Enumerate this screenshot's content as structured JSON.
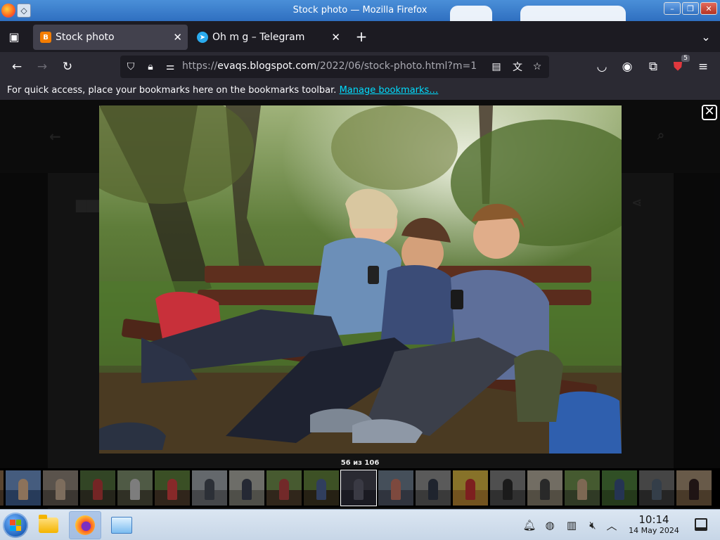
{
  "window": {
    "title": "Stock photo — Mozilla Firefox"
  },
  "tabs": [
    {
      "label": "Stock photo",
      "favicon": "blogger-icon",
      "active": true
    },
    {
      "label": "Oh m g – Telegram",
      "favicon": "telegram-icon",
      "active": false
    }
  ],
  "address": {
    "scheme": "https://",
    "host": "evaqs.blogspot.com",
    "path": "/2022/06/stock-photo.html?m=1",
    "extensions_badge": "5"
  },
  "bookmarks_bar": {
    "message": "For quick access, place your bookmarks here on the bookmarks toolbar.",
    "link": "Manage bookmarks…"
  },
  "lightbox": {
    "counter": "56 из 106",
    "close_symbol": "✕",
    "photo_description_icon": "photo-children-on-bench",
    "thumbnail_count": 20,
    "active_thumbnail": 10
  },
  "taskbar": {
    "time": "10:14",
    "date": "14 May 2024"
  },
  "colors": {
    "link": "#00ddff",
    "active_tab": "#42414d",
    "toolbar": "#2b2a33",
    "tab_strip": "#1c1b22"
  }
}
